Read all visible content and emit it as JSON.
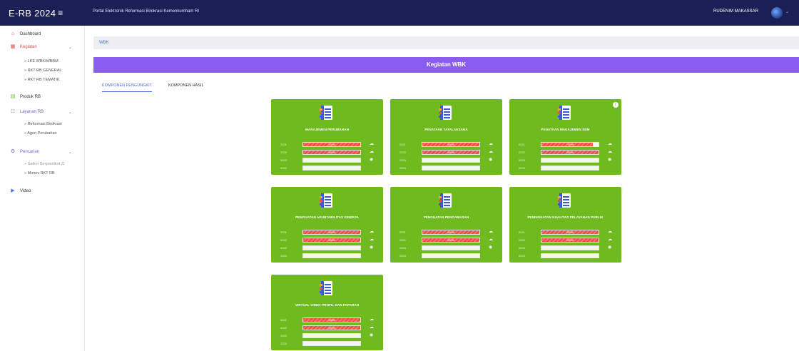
{
  "header": {
    "brand": "E-RB 2024",
    "menu_glyph": "≡",
    "portal_title": "Portal Elektronik Reformasi Birokrasi Kemenkumham RI",
    "user_name": "RUDENIM MAKASSAR",
    "avatar_caret": "⌄"
  },
  "sidebar": {
    "items": [
      {
        "label": "Dashboard",
        "icon": "home-icon",
        "glyph": "⌂"
      },
      {
        "label": "Kegiatan",
        "icon": "calendar-icon",
        "glyph": "▦",
        "chev": "⌄"
      },
      {
        "label": "Produk RB",
        "icon": "document-icon",
        "glyph": "▤"
      },
      {
        "label": "Layanan RB",
        "icon": "service-icon",
        "glyph": "☷",
        "chev": "⌄"
      },
      {
        "label": "Pencarian",
        "icon": "search-icon",
        "glyph": "⚙",
        "chev": "⌄"
      },
      {
        "label": "Video",
        "icon": "video-icon",
        "glyph": "▶"
      }
    ],
    "sub_kegiatan": [
      "» LKE WBK/WBBM",
      "» RKT RB GENERAL",
      "» RKT RB TEMATIK"
    ],
    "sub_layanan": [
      "» Reformasi Birokrasi",
      "» Agen Perubahan"
    ],
    "sub_pencarian": [
      "» Satker Berpredikat ZI",
      "» Monev RKT RB"
    ]
  },
  "breadcrumb": "WBK",
  "banner": "Kegiatan WBK",
  "tabs": [
    "KOMPONEN PENGUNGKIT",
    "KOMPONEN HASIL"
  ],
  "colors": {
    "topbar": "#1a2055",
    "card_green": "#6fba1e",
    "banner_purple": "#8a5cf0",
    "progress_red": "#ef4b48"
  },
  "cards": [
    {
      "title": "MANAJEMEN PERUBAHAN",
      "badge": "",
      "rows": [
        {
          "year": "2021",
          "progress": 100,
          "label": "100%"
        },
        {
          "year": "2022",
          "progress": 100,
          "label": "100%"
        },
        {
          "year": "2023",
          "progress": 0,
          "label": ""
        },
        {
          "year": "2024",
          "progress": 0,
          "label": ""
        }
      ]
    },
    {
      "title": "PENATAAN TATALAKSANA",
      "badge": "",
      "rows": [
        {
          "year": "2021",
          "progress": 100,
          "label": "100%"
        },
        {
          "year": "2022",
          "progress": 100,
          "label": "100%"
        },
        {
          "year": "2023",
          "progress": 0,
          "label": ""
        },
        {
          "year": "2024",
          "progress": 0,
          "label": ""
        }
      ]
    },
    {
      "title": "PENATAAN MANAJEMEN SDM",
      "badge": "!",
      "rows": [
        {
          "year": "2021",
          "progress": 90,
          "label": "~90%"
        },
        {
          "year": "2022",
          "progress": 100,
          "label": "100%"
        },
        {
          "year": "2023",
          "progress": 0,
          "label": ""
        },
        {
          "year": "2024",
          "progress": 0,
          "label": ""
        }
      ]
    },
    {
      "title": "PENGUATAN AKUNTABILITAS KINERJA",
      "badge": "",
      "rows": [
        {
          "year": "2021",
          "progress": 100,
          "label": "100%"
        },
        {
          "year": "2022",
          "progress": 100,
          "label": "100%"
        },
        {
          "year": "2023",
          "progress": 0,
          "label": ""
        },
        {
          "year": "2024",
          "progress": 0,
          "label": ""
        }
      ]
    },
    {
      "title": "PENGUATAN PENGAWASAN",
      "badge": "",
      "rows": [
        {
          "year": "2021",
          "progress": 100,
          "label": "100%"
        },
        {
          "year": "2022",
          "progress": 100,
          "label": "100%"
        },
        {
          "year": "2023",
          "progress": 0,
          "label": ""
        },
        {
          "year": "2024",
          "progress": 0,
          "label": ""
        }
      ]
    },
    {
      "title": "PENINGKATAN KUALITAS PELAYANAN PUBLIK",
      "badge": "",
      "rows": [
        {
          "year": "2021",
          "progress": 100,
          "label": "100%"
        },
        {
          "year": "2022",
          "progress": 100,
          "label": "100%"
        },
        {
          "year": "2023",
          "progress": 0,
          "label": ""
        },
        {
          "year": "2024",
          "progress": 0,
          "label": ""
        }
      ]
    },
    {
      "title": "VIRTUAL VIDEO PROFIL DAN PAPARAN",
      "badge": "",
      "rows": [
        {
          "year": "2021",
          "progress": 100,
          "label": "100%"
        },
        {
          "year": "2022",
          "progress": 100,
          "label": "100%"
        },
        {
          "year": "2023",
          "progress": 0,
          "label": ""
        },
        {
          "year": "2024",
          "progress": 0,
          "label": ""
        }
      ]
    }
  ]
}
